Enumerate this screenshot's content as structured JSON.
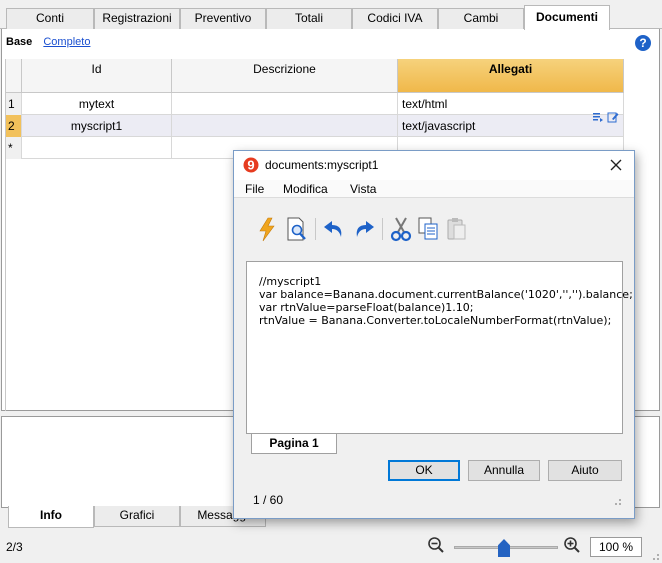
{
  "top_tabs": [
    "Conti",
    "Registrazioni",
    "Preventivo",
    "Totali",
    "Codici IVA",
    "Cambi",
    "Documenti"
  ],
  "subnav": {
    "base": "Base",
    "complete": "Completo"
  },
  "help_glyph": "?",
  "columns": {
    "id": "Id",
    "description": "Descrizione",
    "attachments": "Allegati"
  },
  "rows": [
    {
      "num": "1",
      "id": "mytext",
      "description": "",
      "attachment": "text/html"
    },
    {
      "num": "2",
      "id": "myscript1",
      "description": "",
      "attachment": "text/javascript"
    },
    {
      "num": "*",
      "id": "",
      "description": "",
      "attachment": ""
    }
  ],
  "bottom_tabs": [
    "Info",
    "Grafici",
    "Messaggi"
  ],
  "status": {
    "position": "2/3"
  },
  "zoom": {
    "value": "100 %",
    "fraction": 0.5
  },
  "dialog": {
    "logo_glyph": "9",
    "title": "documents:myscript1",
    "menu": [
      "File",
      "Modifica",
      "Vista"
    ],
    "code_lines": [
      "//myscript1",
      "var balance=Banana.document.currentBalance('1020','','').balance;",
      "var rtnValue=parseFloat(balance)1.10;",
      "rtnValue = Banana.Converter.toLocaleNumberFormat(rtnValue);"
    ],
    "page_tab": "Pagina 1",
    "buttons": {
      "ok": "OK",
      "cancel": "Annulla",
      "help": "Aiuto"
    },
    "status": "1 / 60"
  },
  "colors": {
    "accent": "#f2c15b",
    "link": "#1a4fd0",
    "icon_blue": "#1e62c8"
  }
}
